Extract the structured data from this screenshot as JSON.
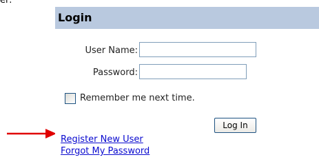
{
  "fragment_text": "er:",
  "panel": {
    "title": "Login"
  },
  "form": {
    "user_name_label": "User Name:",
    "user_name_value": "",
    "password_label": "Password:",
    "password_value": "",
    "remember_label": "Remember me next time.",
    "remember_checked": false,
    "login_button_label": "Log In"
  },
  "links": {
    "register": "Register New User",
    "forgot_password": "Forgot My Password"
  },
  "colors": {
    "header_bg": "#b9c9df",
    "link": "#0a0acf",
    "arrow": "#e00000"
  }
}
